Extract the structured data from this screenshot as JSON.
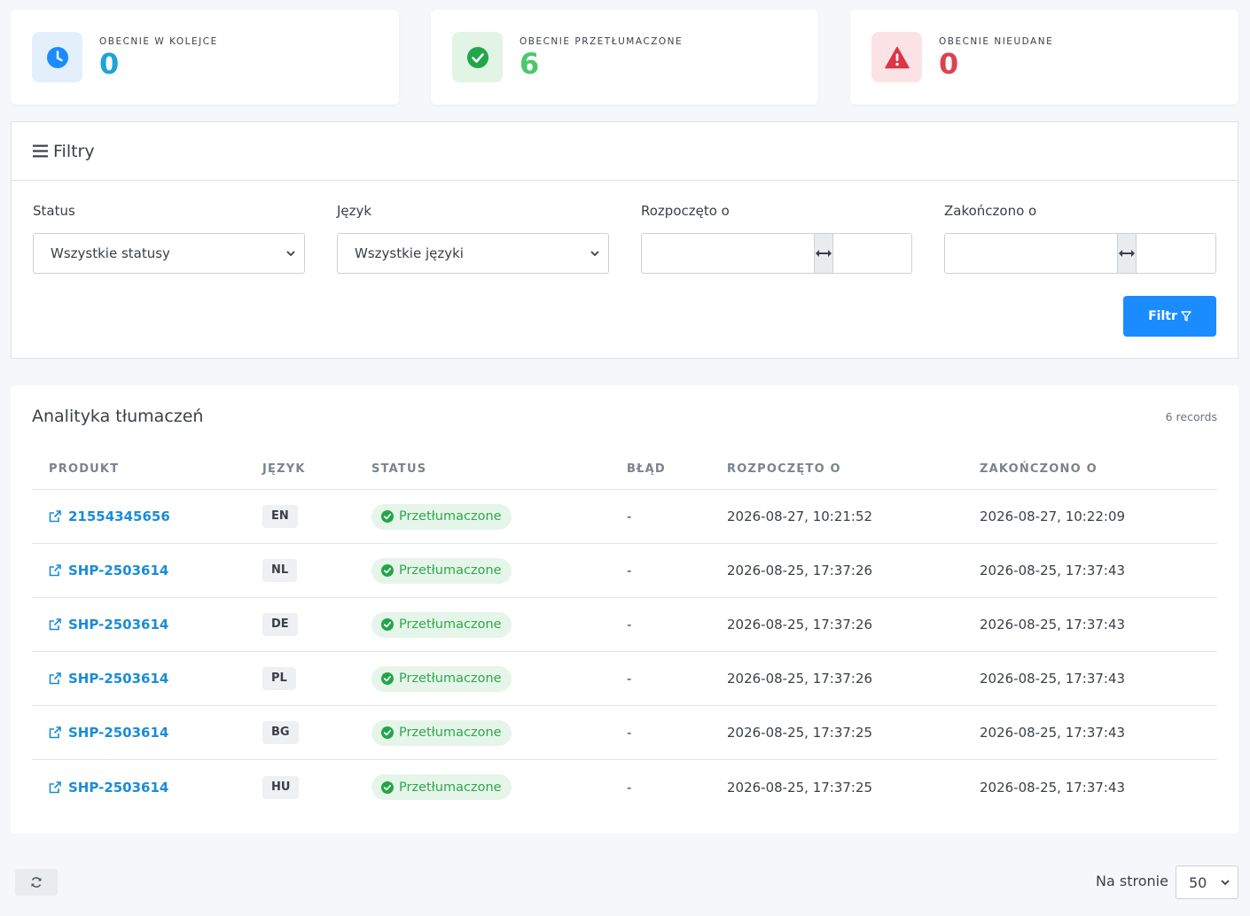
{
  "stats": {
    "queue": {
      "label": "OBECNIE W KOLEJCE",
      "value": "0",
      "icon": "clock-icon",
      "color": "#1fa3d8"
    },
    "translated": {
      "label": "OBECNIE PRZETŁUMACZONE",
      "value": "6",
      "icon": "check-circle-icon",
      "color": "#4cc86a"
    },
    "failed": {
      "label": "OBECNIE NIEUDANE",
      "value": "0",
      "icon": "warning-icon",
      "color": "#dc4350"
    }
  },
  "filters": {
    "title": "Filtry",
    "status": {
      "label": "Status",
      "selected": "Wszystkie statusy"
    },
    "language": {
      "label": "Język",
      "selected": "Wszystkie języki"
    },
    "started": {
      "label": "Rozpoczęto o",
      "from": "",
      "to": ""
    },
    "ended": {
      "label": "Zakończono o",
      "from": "",
      "to": ""
    },
    "button_label": "Filtr"
  },
  "analytics": {
    "title": "Analityka tłumaczeń",
    "records": "6 records",
    "columns": [
      "PRODUKT",
      "JĘZYK",
      "STATUS",
      "BŁĄD",
      "ROZPOCZĘTO O",
      "ZAKOŃCZONO O"
    ],
    "rows": [
      {
        "product": "21554345656",
        "language": "EN",
        "status": "Przetłumaczone",
        "error": "-",
        "started": "2026-08-27, 10:21:52",
        "ended": "2026-08-27, 10:22:09"
      },
      {
        "product": "SHP-2503614",
        "language": "NL",
        "status": "Przetłumaczone",
        "error": "-",
        "started": "2026-08-25, 17:37:26",
        "ended": "2026-08-25, 17:37:43"
      },
      {
        "product": "SHP-2503614",
        "language": "DE",
        "status": "Przetłumaczone",
        "error": "-",
        "started": "2026-08-25, 17:37:26",
        "ended": "2026-08-25, 17:37:43"
      },
      {
        "product": "SHP-2503614",
        "language": "PL",
        "status": "Przetłumaczone",
        "error": "-",
        "started": "2026-08-25, 17:37:26",
        "ended": "2026-08-25, 17:37:43"
      },
      {
        "product": "SHP-2503614",
        "language": "BG",
        "status": "Przetłumaczone",
        "error": "-",
        "started": "2026-08-25, 17:37:25",
        "ended": "2026-08-25, 17:37:43"
      },
      {
        "product": "SHP-2503614",
        "language": "HU",
        "status": "Przetłumaczone",
        "error": "-",
        "started": "2026-08-25, 17:37:25",
        "ended": "2026-08-25, 17:37:43"
      }
    ]
  },
  "footer": {
    "per_page_label": "Na stronie",
    "per_page_value": "50"
  }
}
